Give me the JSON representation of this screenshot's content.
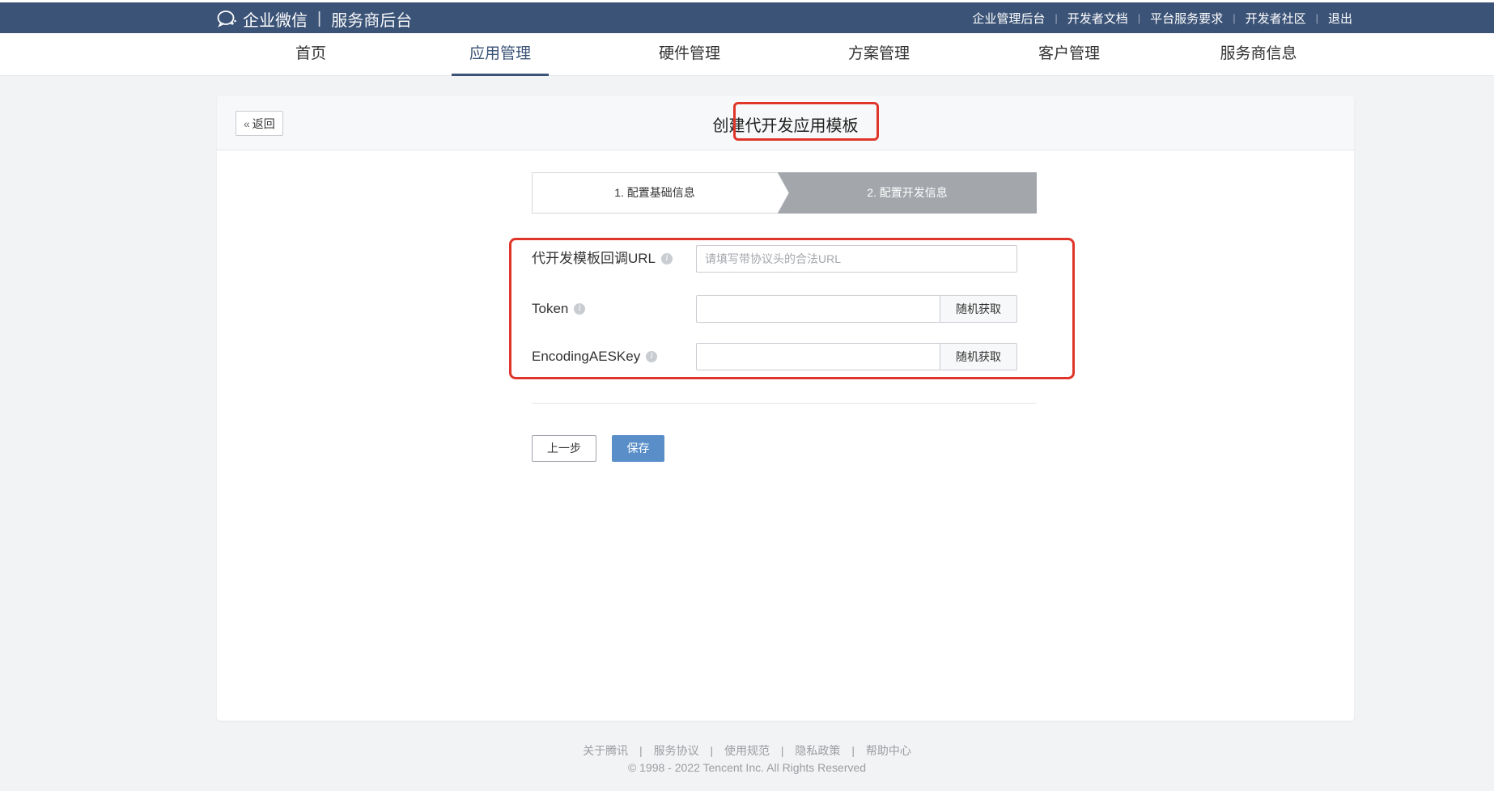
{
  "header": {
    "brand_name": "企业微信",
    "brand_separator": "|",
    "brand_subtitle": "服务商后台",
    "links": [
      "企业管理后台",
      "开发者文档",
      "平台服务要求",
      "开发者社区",
      "退出"
    ]
  },
  "nav": {
    "items": [
      "首页",
      "应用管理",
      "硬件管理",
      "方案管理",
      "客户管理",
      "服务商信息"
    ],
    "active": "应用管理"
  },
  "page": {
    "back_label": "返回",
    "title": "创建代开发应用模板"
  },
  "steps": [
    "1. 配置基础信息",
    "2. 配置开发信息"
  ],
  "form": {
    "callback_url": {
      "label": "代开发模板回调URL",
      "placeholder": "请填写带协议头的合法URL",
      "value": ""
    },
    "token": {
      "label": "Token",
      "value": "",
      "button": "随机获取"
    },
    "aes_key": {
      "label": "EncodingAESKey",
      "value": "",
      "button": "随机获取"
    }
  },
  "actions": {
    "prev_label": "上一步",
    "save_label": "保存"
  },
  "footer": {
    "links": [
      "关于腾讯",
      "服务协议",
      "使用规范",
      "隐私政策",
      "帮助中心"
    ],
    "copyright": "© 1998 - 2022 Tencent Inc. All Rights Reserved"
  },
  "colors": {
    "topbar": "#3b5377",
    "nav_active": "#3b5377",
    "save_button": "#5a8ec9",
    "step_active": "#a3a6ab",
    "highlight": "#e0362a"
  }
}
